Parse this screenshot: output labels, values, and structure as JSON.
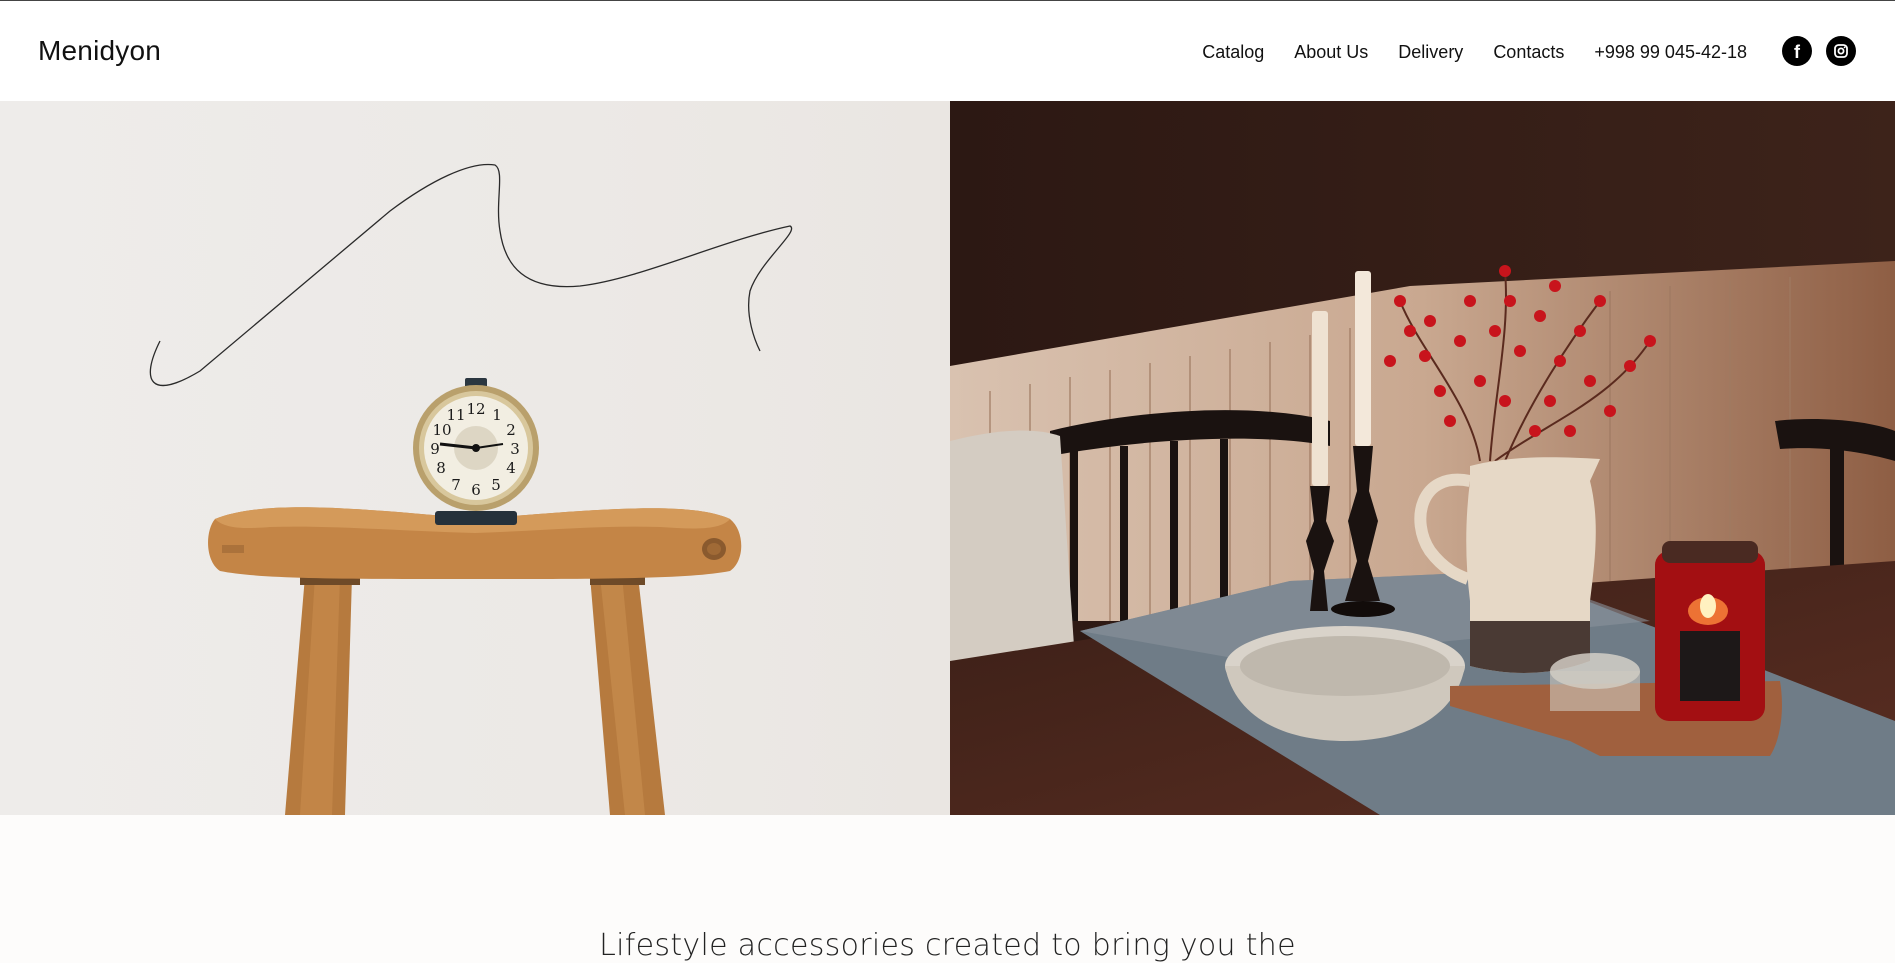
{
  "header": {
    "logo": "Menidyon",
    "nav": [
      {
        "label": "Catalog"
      },
      {
        "label": "About Us"
      },
      {
        "label": "Delivery"
      },
      {
        "label": "Contacts"
      }
    ],
    "phone": "+998 99 045-42-18",
    "social": [
      {
        "icon": "facebook-icon",
        "glyph": "f"
      },
      {
        "icon": "instagram-icon"
      }
    ]
  },
  "hero": {
    "left_image": "wooden-stool-with-alarm-clock",
    "right_image": "dining-table-with-candles-berries-pitcher"
  },
  "tagline": "Lifestyle accessories created to bring you the"
}
